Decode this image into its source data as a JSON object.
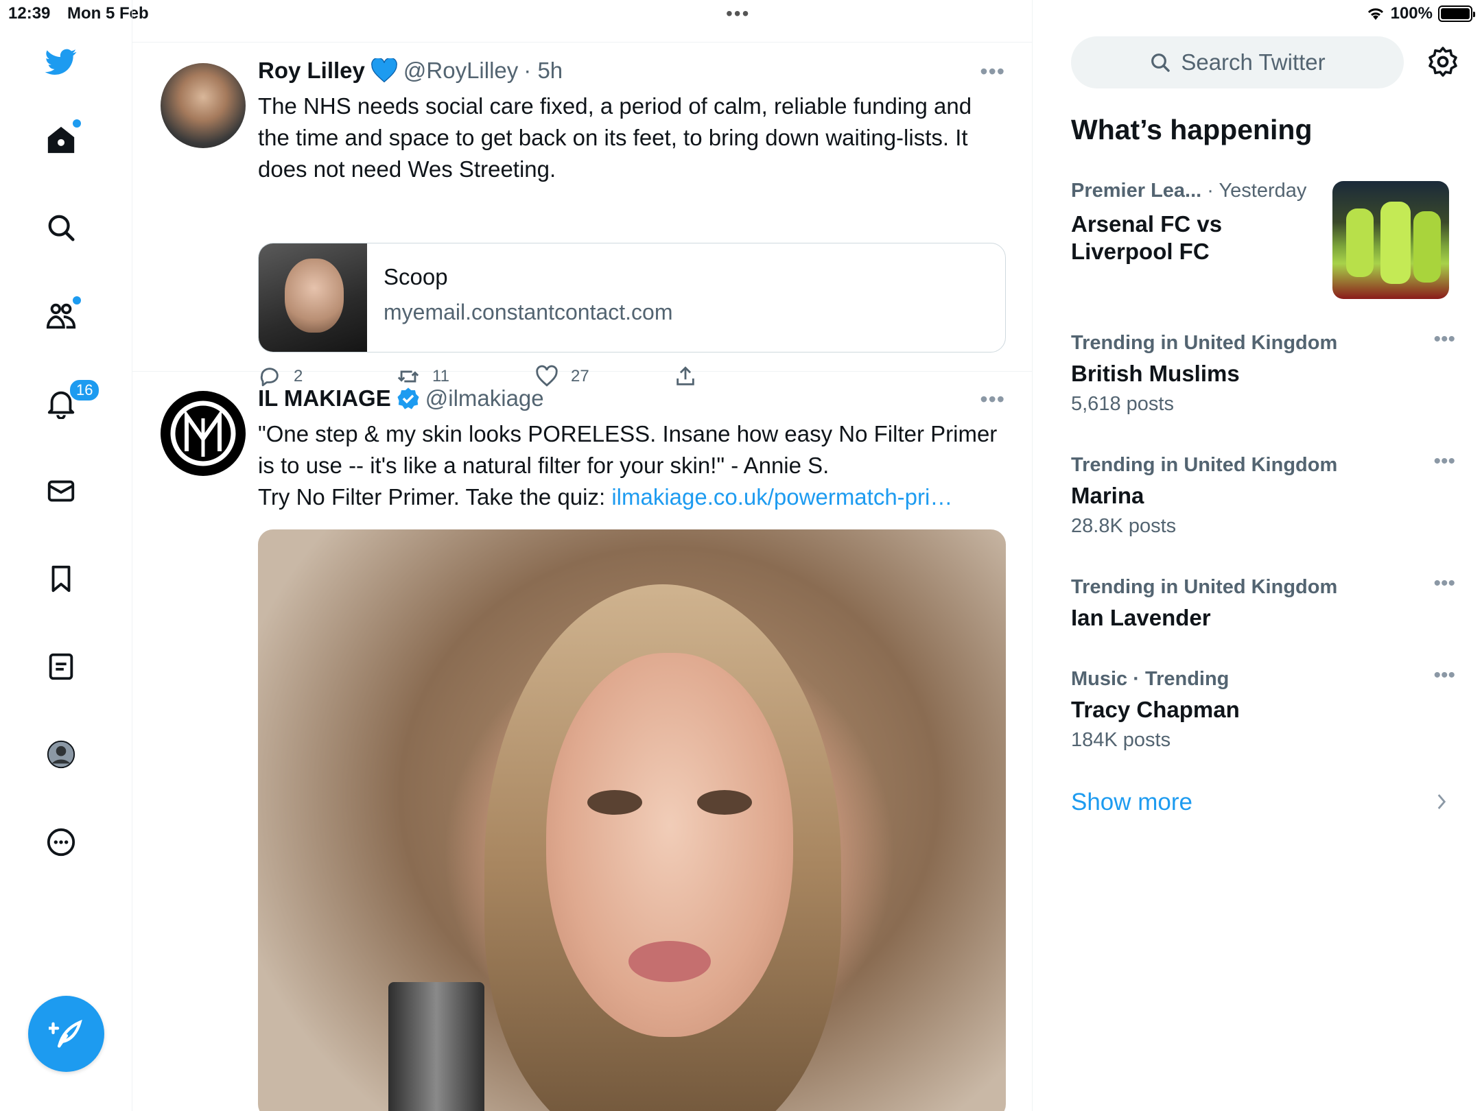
{
  "status_bar": {
    "time": "12:39",
    "date": "Mon 5 Feb",
    "battery": "100%",
    "dots": "•••"
  },
  "nav": {
    "notifications_count": "16"
  },
  "tweets": [
    {
      "name": "Roy Lilley",
      "handle": "@RoyLilley",
      "time": "· 5h",
      "more": "•••",
      "text": "The NHS needs social care fixed, a period of calm, reliable funding and the time and space to get back on its feet, to bring down waiting-lists. It does not need Wes Streeting.",
      "card": {
        "title": "Scoop",
        "domain": "myemail.constantcontact.com"
      },
      "replies": "2",
      "retweets": "11",
      "likes": "27"
    },
    {
      "name": "IL MAKIAGE",
      "handle": "@ilmakiage",
      "more": "•••",
      "text_line1": "\"One step & my skin looks PORELESS. Insane how easy No Filter Primer is to use -- it's like a natural filter for your skin!\" - Annie S.",
      "text_line2": "Try No Filter Primer. Take the quiz: ",
      "link": "ilmakiage.co.uk/powermatch-pri…"
    }
  ],
  "sidebar": {
    "search_placeholder": "Search Twitter",
    "heading": "What’s happening",
    "news": {
      "category": "Premier Lea...",
      "time": "· Yesterday",
      "title_line1": "Arsenal FC vs",
      "title_line2": "Liverpool FC"
    },
    "trends": [
      {
        "meta": "Trending in United Kingdom",
        "title": "British Muslims",
        "count": "5,618 posts"
      },
      {
        "meta": "Trending in United Kingdom",
        "title": "Marina",
        "count": "28.8K posts"
      },
      {
        "meta": "Trending in United Kingdom",
        "title": "Ian Lavender",
        "count": ""
      },
      {
        "meta": "Music · Trending",
        "title": "Tracy Chapman",
        "count": "184K posts"
      }
    ],
    "trend_more": "•••",
    "show_more": "Show more"
  },
  "colors": {
    "accent": "#1d9bf0",
    "text": "#0f1419",
    "secondary": "#536471",
    "border": "#eff3f4"
  }
}
